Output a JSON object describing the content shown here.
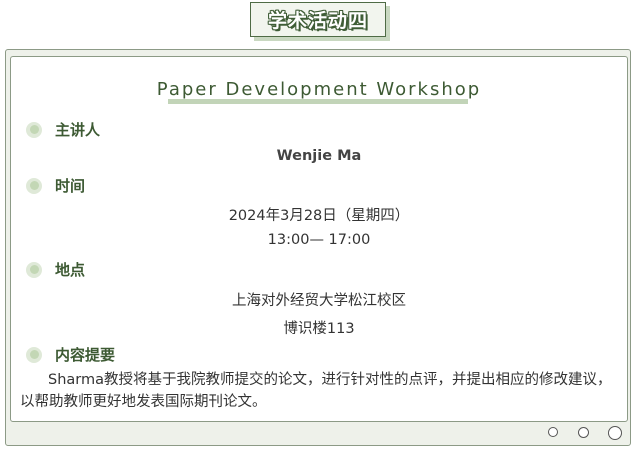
{
  "badge": {
    "title": "学术活动四"
  },
  "workshop": {
    "title": "Paper Development Workshop"
  },
  "speaker": {
    "label": "主讲人",
    "name": "Wenjie Ma"
  },
  "time": {
    "label": "时间",
    "date": "2024年3月28日（星期四）",
    "hours": "13:00— 17:00"
  },
  "location": {
    "label": "地点",
    "campus": "上海对外经贸大学松江校区",
    "room": "博识楼113"
  },
  "summary": {
    "label": "内容提要",
    "text": "Sharma教授将基于我院教师提交的论文，进行针对性的点评，并提出相应的修改建议，以帮助教师更好地发表国际期刊论文。"
  },
  "colors": {
    "accent_green": "#3d5a33",
    "light_green": "#c2d4b8",
    "frame_bg": "#eef1ea"
  },
  "icons": [
    "section-bullet-icon",
    "decorative-circle-icon"
  ]
}
